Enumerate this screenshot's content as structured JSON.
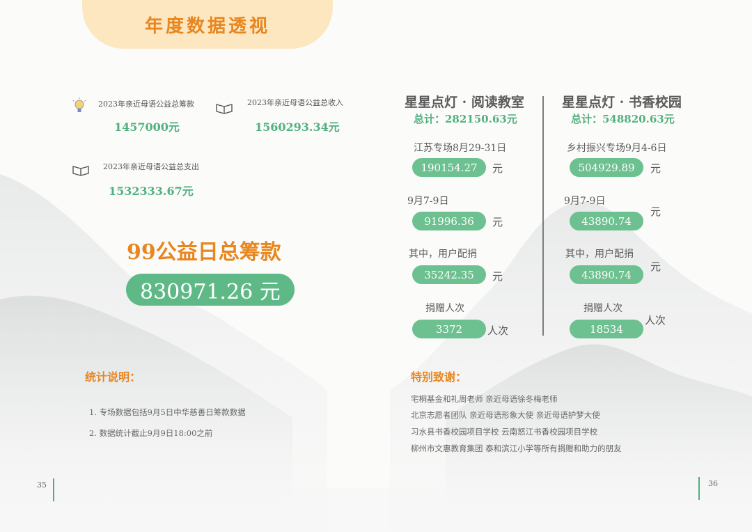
{
  "header": {
    "title": "年度数据透视"
  },
  "annual": {
    "donations_label": "2023年亲近母语公益总筹款",
    "donations_value": "1457000元",
    "income_label": "2023年亲近母语公益总收入",
    "income_value": "1560293.34元",
    "expense_label": "2023年亲近母语公益总支出",
    "expense_value": "1532333.67元"
  },
  "day99": {
    "title": "99公益日总筹款",
    "value": "830971.26 元"
  },
  "project_reading": {
    "title": "星星点灯 · 阅读教室",
    "total": "总计：282150.63元",
    "rows": [
      {
        "label": "江苏专场8月29-31日",
        "value": "190154.27",
        "unit": "元"
      },
      {
        "label": "9月7-9日",
        "value": "91996.36",
        "unit": "元"
      },
      {
        "label": "其中，用户配捐",
        "value": "35242.35",
        "unit": "元"
      },
      {
        "label": "捐赠人次",
        "value": "3372",
        "unit": "人次"
      }
    ]
  },
  "project_campus": {
    "title": "星星点灯 · 书香校园",
    "total": "总计：548820.63元",
    "rows": [
      {
        "label": "乡村振兴专场9月4-6日",
        "value": "504929.89",
        "unit": "元"
      },
      {
        "label": "9月7-9日",
        "value": "43890.74",
        "unit": "元"
      },
      {
        "label": "其中，用户配捐",
        "value": "43890.74",
        "unit": "元"
      },
      {
        "label": "捐赠人次",
        "value": "18534",
        "unit": "人次"
      }
    ]
  },
  "notes": {
    "title": "统计说明：",
    "items": [
      "1. 专场数据包括9月5日中华慈善日筹款数据",
      "2. 数据统计截止9月9日18:00之前"
    ]
  },
  "thanks": {
    "title": "特别致谢：",
    "lines": [
      "宅桐基金和礼周老师 亲近母语徐冬梅老师",
      "北京志愿者团队 亲近母语形象大使 亲近母语护梦大使",
      "习水县书香校园项目学校 云南怒江书香校园项目学校",
      "柳州市文惠教育集团 泰和滨江小学等所有捐赠和助力的朋友"
    ]
  },
  "pages": {
    "left": "35",
    "right": "36"
  },
  "colors": {
    "orange": "#e8861f",
    "green": "#52b07e",
    "tab": "#fde7c1"
  },
  "icons": {
    "donations": "lightbulb-icon",
    "income": "open-book-icon",
    "expense": "open-book-icon"
  }
}
